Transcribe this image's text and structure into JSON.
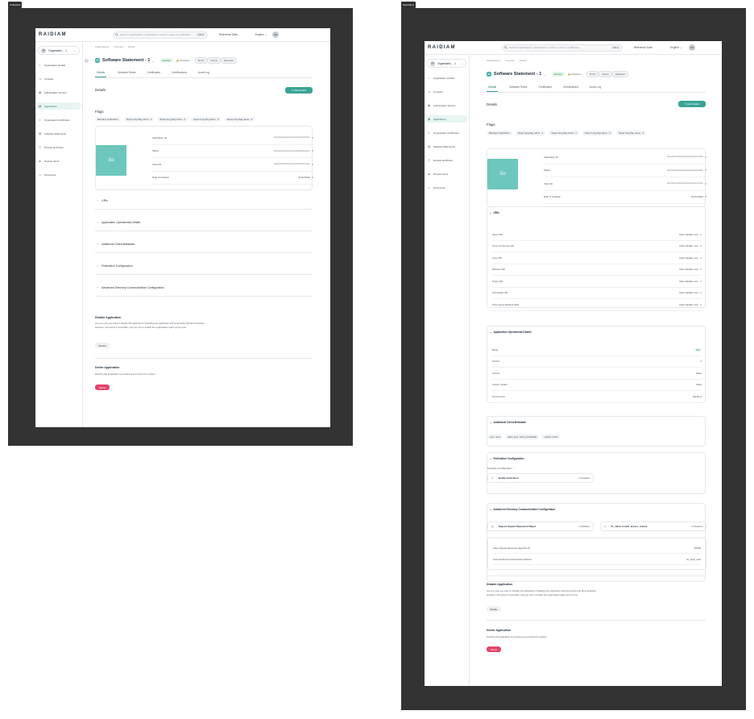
{
  "labels": {
    "left": "Collapsed",
    "right": "Expanded"
  },
  "header": {
    "logo": "RAIDIAM",
    "search_placeholder": "Search organisations, applications, servers, users or certificates",
    "shortcut": "Ctrl K",
    "environment": "Reference Data",
    "language": "English",
    "avatar_initials": "RD"
  },
  "sidebar": {
    "org_initials": "OA",
    "org_name": "Organisatio… 1",
    "items": [
      {
        "label": "Organisation Details",
        "icon": "building-icon"
      },
      {
        "label": "Contacts",
        "icon": "contacts-icon"
      },
      {
        "label": "Authorisation Servers",
        "icon": "server-icon"
      },
      {
        "label": "Applications",
        "icon": "grid-icon",
        "active": true
      },
      {
        "label": "Organisation Certificates",
        "icon": "key-icon"
      },
      {
        "label": "Software Statements",
        "icon": "document-icon"
      },
      {
        "label": "Domain and Roles",
        "icon": "domain-icon"
      },
      {
        "label": "Domain Users",
        "icon": "users-icon"
      },
      {
        "label": "Documents",
        "icon": "file-icon"
      }
    ]
  },
  "breadcrumb": [
    "Organisations",
    "Overview",
    "Details"
  ],
  "title": {
    "icon_initials": "SS",
    "name": "Software Statement - 1",
    "status": "Active",
    "unlocked": "Unlocked",
    "tags": [
      "MTLS",
      "Clients",
      "Redacted"
    ]
  },
  "tabs": [
    "Details",
    "Software Roles",
    "Certificates",
    "Certifications",
    "Audit Log"
  ],
  "details_title": "Details",
  "edit_button": "Edit Details",
  "flags_title": "Flags",
  "flags": [
    "Barclays Institutions",
    "Super long flag name - 1",
    "Super long flag name - 2",
    "Super long flag name - 3",
    "Super long flag name - 4"
  ],
  "info": {
    "logo_initials": "So",
    "rows": [
      {
        "label": "Application ID",
        "value": "xxxxxxxxxxxxxxxxxxxxxxxxxx"
      },
      {
        "label": "Status",
        "value": "xxxxxxxxxxxxxxxxxxxxxxxxxx"
      },
      {
        "label": "Client ID",
        "value": "xxxxxxxxxxxxxxxxxxxxxxxxxx"
      },
      {
        "label": "Date of Creation",
        "value": "01/01/2024"
      }
    ]
  },
  "sections": [
    "URIs",
    "Application Operational Details",
    "Additional Client Metadata",
    "Federation Configuration",
    "Advanced Directory Communication Configuration"
  ],
  "uris": [
    {
      "label": "Client URI",
      "value": "https://raidiam.com"
    },
    {
      "label": "Terms Of Service URI",
      "value": "https://raidiam.com"
    },
    {
      "label": "Logo URI",
      "value": "https://raidiam.com"
    },
    {
      "label": "Redirect URI",
      "value": "https://raidiam.com"
    },
    {
      "label": "Origin URI",
      "value": "https://raidiam.com"
    },
    {
      "label": "Homepage URI",
      "value": "https://raidiam.com"
    },
    {
      "label": "Post Logout Redirect URIs",
      "value": "https://raidiam.com"
    }
  ],
  "operational": [
    {
      "label": "Mode",
      "value": "Live"
    },
    {
      "label": "Version",
      "value": "2"
    },
    {
      "label": "Locked",
      "value": "False"
    },
    {
      "label": "Custom Tenant",
      "value": "False"
    },
    {
      "label": "Environment",
      "value": "Sandbox"
    }
  ],
  "metadata_chips": [
    "type: none",
    "grant_type: client_credentials",
    "update: prefix"
  ],
  "federation": {
    "subtitle": "Federation Configuration",
    "item": "Enable Federation",
    "status": "Disabled"
  },
  "advanced": {
    "items": [
      {
        "label": "Require Signed Requested Object",
        "status": "Disabled"
      },
      {
        "label": "tls_client_bound_access_tokens",
        "status": "Disabled"
      }
    ],
    "rows": [
      {
        "label": "Token Signed Response Algorithm ID",
        "value": "PS256"
      },
      {
        "label": "Token Endpoint Authentication Method",
        "value": "tls_client_auth"
      }
    ]
  },
  "disable": {
    "title": "Disable Application",
    "text1": "Are you sure you want to disable this application? Disabling the application will temporarily halt all its activities.",
    "text2": "However, this action is reversible, and you can re-enable the organisation again at any time.",
    "button": "Disable"
  },
  "delete": {
    "title": "Delete Application",
    "text": "Deleting the application is permanent and cannot be undone.",
    "button": "Delete"
  }
}
